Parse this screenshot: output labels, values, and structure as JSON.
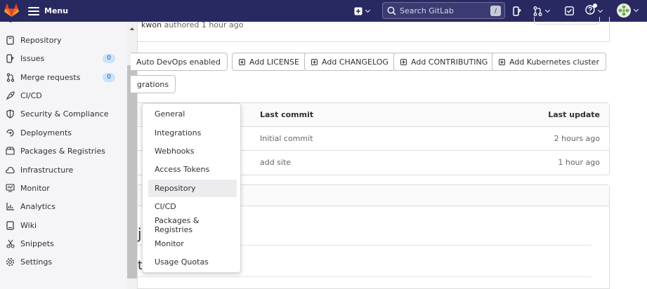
{
  "topbar": {
    "menu_label": "Menu",
    "search_placeholder": "Search GitLab",
    "search_shortcut": "/"
  },
  "sidebar": {
    "items": [
      {
        "label": "Repository",
        "icon": "repository-icon"
      },
      {
        "label": "Issues",
        "icon": "issues-icon",
        "badge": "0"
      },
      {
        "label": "Merge requests",
        "icon": "merge-request-icon",
        "badge": "0"
      },
      {
        "label": "CI/CD",
        "icon": "rocket-icon"
      },
      {
        "label": "Security & Compliance",
        "icon": "shield-icon"
      },
      {
        "label": "Deployments",
        "icon": "deployments-icon"
      },
      {
        "label": "Packages & Registries",
        "icon": "package-icon"
      },
      {
        "label": "Infrastructure",
        "icon": "cloud-icon"
      },
      {
        "label": "Monitor",
        "icon": "monitor-icon"
      },
      {
        "label": "Analytics",
        "icon": "chart-icon"
      },
      {
        "label": "Wiki",
        "icon": "book-icon"
      },
      {
        "label": "Snippets",
        "icon": "scissors-icon"
      },
      {
        "label": "Settings",
        "icon": "gear-icon"
      }
    ]
  },
  "commit_info": {
    "author": "kwon",
    "text": " authored 1 hour ago"
  },
  "actions": {
    "auto_devops": "Auto DevOps enabled",
    "add_license": "Add LICENSE",
    "add_changelog": "Add CHANGELOG",
    "add_contributing": "Add CONTRIBUTING",
    "add_kubernetes": "Add Kubernetes cluster",
    "integrations_fragment": "grations"
  },
  "files_table": {
    "col_last_commit": "Last commit",
    "col_last_update": "Last update",
    "rows": [
      {
        "commit": "Initial commit",
        "updated": "2 hours ago"
      },
      {
        "commit": "add site",
        "updated": "1 hour ago"
      }
    ]
  },
  "settings_menu": {
    "items": [
      "General",
      "Integrations",
      "Webhooks",
      "Access Tokens",
      "Repository",
      "CI/CD",
      "Packages & Registries",
      "Monitor",
      "Usage Quotas"
    ],
    "active": "Repository"
  },
  "readme_fragments": [
    "j",
    "t"
  ],
  "colors": {
    "topbar": "#292961",
    "sidebar": "#f5f5f7",
    "badge_bg": "#cbe2f9",
    "badge_text": "#0b5cad"
  }
}
